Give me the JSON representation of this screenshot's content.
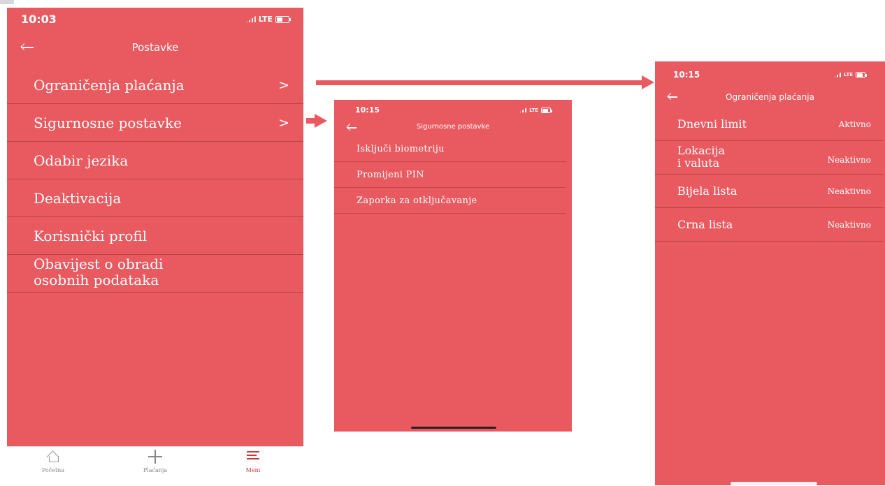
{
  "screen1": {
    "status": {
      "time": "10:03",
      "network": "LTE"
    },
    "nav": {
      "title": "Postavke"
    },
    "items": [
      {
        "label": "Ograničenja plaćanja",
        "chevron": ">"
      },
      {
        "label": "Sigurnosne postavke",
        "chevron": ">"
      },
      {
        "label": "Odabir jezika"
      },
      {
        "label": "Deaktivacija"
      },
      {
        "label": "Korisnički profil"
      },
      {
        "label_line1": "Obavijest o obradi",
        "label_line2": "osobnih podataka"
      }
    ],
    "tabbar": {
      "tabs": [
        {
          "label": "Početna",
          "icon": "home-icon"
        },
        {
          "label": "Plaćanja",
          "icon": "plus-icon"
        },
        {
          "label": "Meni",
          "icon": "menu-icon"
        }
      ]
    }
  },
  "screen2": {
    "status": {
      "time": "10:15",
      "network": "LTE"
    },
    "nav": {
      "title": "Sigurnosne postavke"
    },
    "items": [
      {
        "label": "Isključi biometriju"
      },
      {
        "label": "Promijeni PIN"
      },
      {
        "label": "Zaporka za otključavanje"
      }
    ]
  },
  "screen3": {
    "status": {
      "time": "10:15",
      "network": "LTE"
    },
    "nav": {
      "title": "Ograničenja plaćanja"
    },
    "items": [
      {
        "label": "Dnevni limit",
        "status": "Aktivno"
      },
      {
        "label_line1": "Lokacija",
        "label_line2": "i valuta",
        "status": "Neaktivno"
      },
      {
        "label": "Bijela lista",
        "status": "Neaktivno"
      },
      {
        "label": "Crna lista",
        "status": "Neaktivno"
      }
    ]
  },
  "colors": {
    "accent": "#e85a60",
    "active_tab": "#c7353d",
    "background": "#ffffff"
  }
}
